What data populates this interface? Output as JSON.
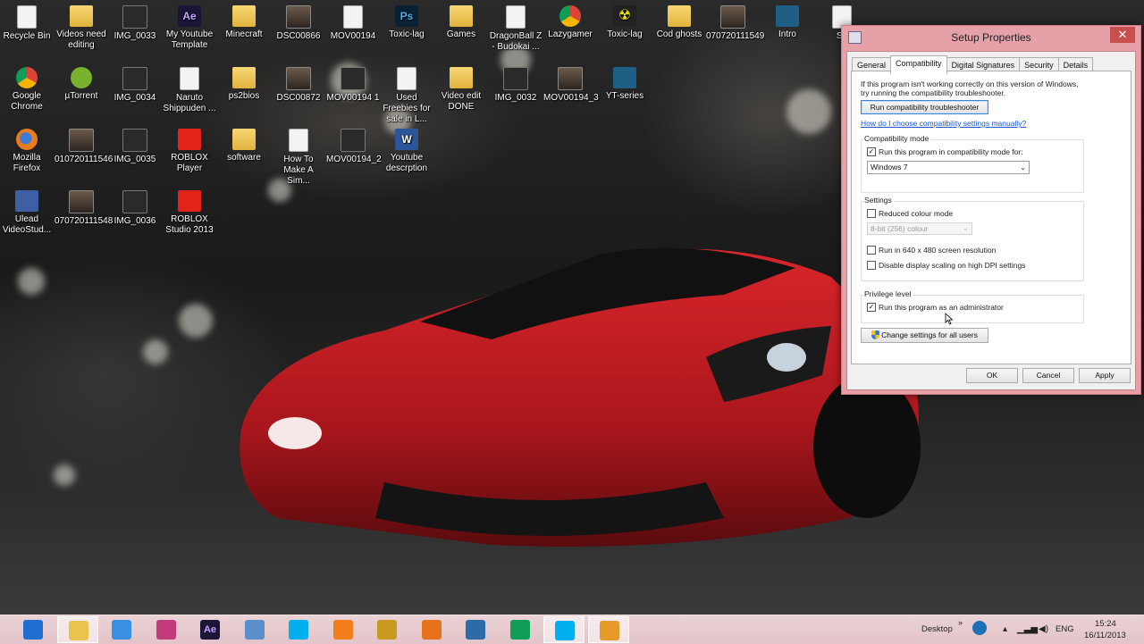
{
  "desktop": {
    "icons": [
      {
        "label": "Recycle Bin",
        "icon": "recycle-bin-icon",
        "kind": "file"
      },
      {
        "label": "Videos need editing",
        "icon": "folder-icon",
        "kind": "folder"
      },
      {
        "label": "IMG_0033",
        "icon": "image-icon",
        "kind": "video"
      },
      {
        "label": "My Youtube Template",
        "icon": "after-effects-icon",
        "kind": "ae"
      },
      {
        "label": "Minecraft",
        "icon": "folder-icon",
        "kind": "folder"
      },
      {
        "label": "DSC00866",
        "icon": "image-icon",
        "kind": "photo"
      },
      {
        "label": "MOV00194",
        "icon": "video-file-icon",
        "kind": "file"
      },
      {
        "label": "Toxic-lag",
        "icon": "photoshop-icon",
        "kind": "ps"
      },
      {
        "label": "Games",
        "icon": "folder-icon",
        "kind": "folder"
      },
      {
        "label": "DragonBall Z - Budokai ...",
        "icon": "file-icon",
        "kind": "file"
      },
      {
        "label": "Lazygamer",
        "icon": "chrome-icon",
        "kind": "chrome"
      },
      {
        "label": "Toxic-lag",
        "icon": "radiation-icon",
        "kind": "toxic"
      },
      {
        "label": "Cod ghosts",
        "icon": "folder-icon",
        "kind": "folder"
      },
      {
        "label": "070720111549",
        "icon": "image-icon",
        "kind": "photo"
      },
      {
        "label": "Intro",
        "icon": "video-icon",
        "kind": "intro"
      },
      {
        "label": "Google Chrome",
        "icon": "chrome-icon",
        "kind": "chrome"
      },
      {
        "label": "µTorrent",
        "icon": "utorrent-icon",
        "kind": "utorrent"
      },
      {
        "label": "IMG_0034",
        "icon": "image-icon",
        "kind": "video"
      },
      {
        "label": "Naruto Shippuden ...",
        "icon": "file-icon",
        "kind": "file"
      },
      {
        "label": "ps2bios",
        "icon": "folder-icon",
        "kind": "folder"
      },
      {
        "label": "DSC00872",
        "icon": "image-icon",
        "kind": "photo"
      },
      {
        "label": "MOV00194 1",
        "icon": "video-icon",
        "kind": "video"
      },
      {
        "label": "Used Freebies for sale in L...",
        "icon": "shortcut-icon",
        "kind": "file"
      },
      {
        "label": "Video edit DONE",
        "icon": "folder-icon",
        "kind": "folder"
      },
      {
        "label": "IMG_0032",
        "icon": "image-icon",
        "kind": "video"
      },
      {
        "label": "MOV00194_3",
        "icon": "video-icon",
        "kind": "photo"
      },
      {
        "label": "YT-series",
        "icon": "video-icon",
        "kind": "intro"
      },
      {
        "label": "Mozilla Firefox",
        "icon": "firefox-icon",
        "kind": "firefox"
      },
      {
        "label": "010720111546",
        "icon": "image-icon",
        "kind": "photo"
      },
      {
        "label": "IMG_0035",
        "icon": "image-icon",
        "kind": "video"
      },
      {
        "label": "ROBLOX Player",
        "icon": "roblox-icon",
        "kind": "roblox"
      },
      {
        "label": "software",
        "icon": "folder-icon",
        "kind": "folder"
      },
      {
        "label": "How To Make A Sim...",
        "icon": "shortcut-icon",
        "kind": "file"
      },
      {
        "label": "MOV00194_2",
        "icon": "video-icon",
        "kind": "video"
      },
      {
        "label": "Youtube descrption",
        "icon": "word-icon",
        "kind": "word"
      },
      {
        "label": "Ulead VideoStud...",
        "icon": "ulead-icon",
        "kind": "ulead"
      },
      {
        "label": "070720111548",
        "icon": "image-icon",
        "kind": "photo"
      },
      {
        "label": "IMG_0036",
        "icon": "image-icon",
        "kind": "video"
      },
      {
        "label": "ROBLOX Studio 2013",
        "icon": "roblox-icon",
        "kind": "roblox"
      },
      {
        "label": "Se",
        "icon": "setup-icon",
        "kind": "file"
      }
    ]
  },
  "dialog": {
    "title": "Setup Properties",
    "close_glyph": "✕",
    "tabs": [
      "General",
      "Compatibility",
      "Digital Signatures",
      "Security",
      "Details"
    ],
    "intro_line1": "If this program isn't working correctly on this version of Windows,",
    "intro_line2": "try running the compatibility troubleshooter.",
    "troubleshooter_button": "Run compatibility troubleshooter",
    "help_link": "How do I choose compatibility settings manually?",
    "compat_group": {
      "title": "Compatibility mode",
      "checkbox_label": "Run this program in compatibility mode for:",
      "checked": true,
      "selected_os": "Windows 7"
    },
    "settings_group": {
      "title": "Settings",
      "reduced_colour": {
        "label": "Reduced colour mode",
        "checked": false
      },
      "colour_select": "8-bit (256) colour",
      "run_640": {
        "label": "Run in 640 x 480 screen resolution",
        "checked": false
      },
      "dpi_scaling": {
        "label": "Disable display scaling on high DPI settings",
        "checked": false
      }
    },
    "privilege_group": {
      "title": "Privilege level",
      "admin": {
        "label": "Run this program as an administrator",
        "checked": true
      }
    },
    "all_users_button": "Change settings for all users",
    "ok": "OK",
    "cancel": "Cancel",
    "apply": "Apply"
  },
  "taskbar": {
    "apps": [
      {
        "name": "internet-explorer-icon",
        "color": "#1e6fd0"
      },
      {
        "name": "file-explorer-icon",
        "color": "#e9c34e",
        "active": true
      },
      {
        "name": "rocket-dock-icon",
        "color": "#3a8fe0"
      },
      {
        "name": "paint-icon",
        "color": "#c23b7a"
      },
      {
        "name": "after-effects-icon",
        "color": "#1b1538",
        "text": "Ae"
      },
      {
        "name": "control-panel-icon",
        "color": "#5b8fc9"
      },
      {
        "name": "skype-icon",
        "color": "#00aff0"
      },
      {
        "name": "origin-icon",
        "color": "#f17d1b"
      },
      {
        "name": "lazygamer-icon",
        "color": "#c99a22"
      },
      {
        "name": "firefox-icon",
        "color": "#e8721b"
      },
      {
        "name": "media-player-icon",
        "color": "#2d6aa8"
      },
      {
        "name": "chrome-icon",
        "color": "#0f9d58"
      },
      {
        "name": "skype-active-icon",
        "color": "#00aff0",
        "active": true
      },
      {
        "name": "media-center-icon",
        "color": "#e69a2a",
        "active": true
      }
    ],
    "desktop_label": "Desktop",
    "language": "ENG",
    "time": "15:24",
    "date": "16/11/2013"
  },
  "colors": {
    "dialog_frame": "#e5a0a8",
    "taskbar": "#e3c4c8",
    "link": "#1a58c9",
    "close_button": "#c7504f"
  }
}
